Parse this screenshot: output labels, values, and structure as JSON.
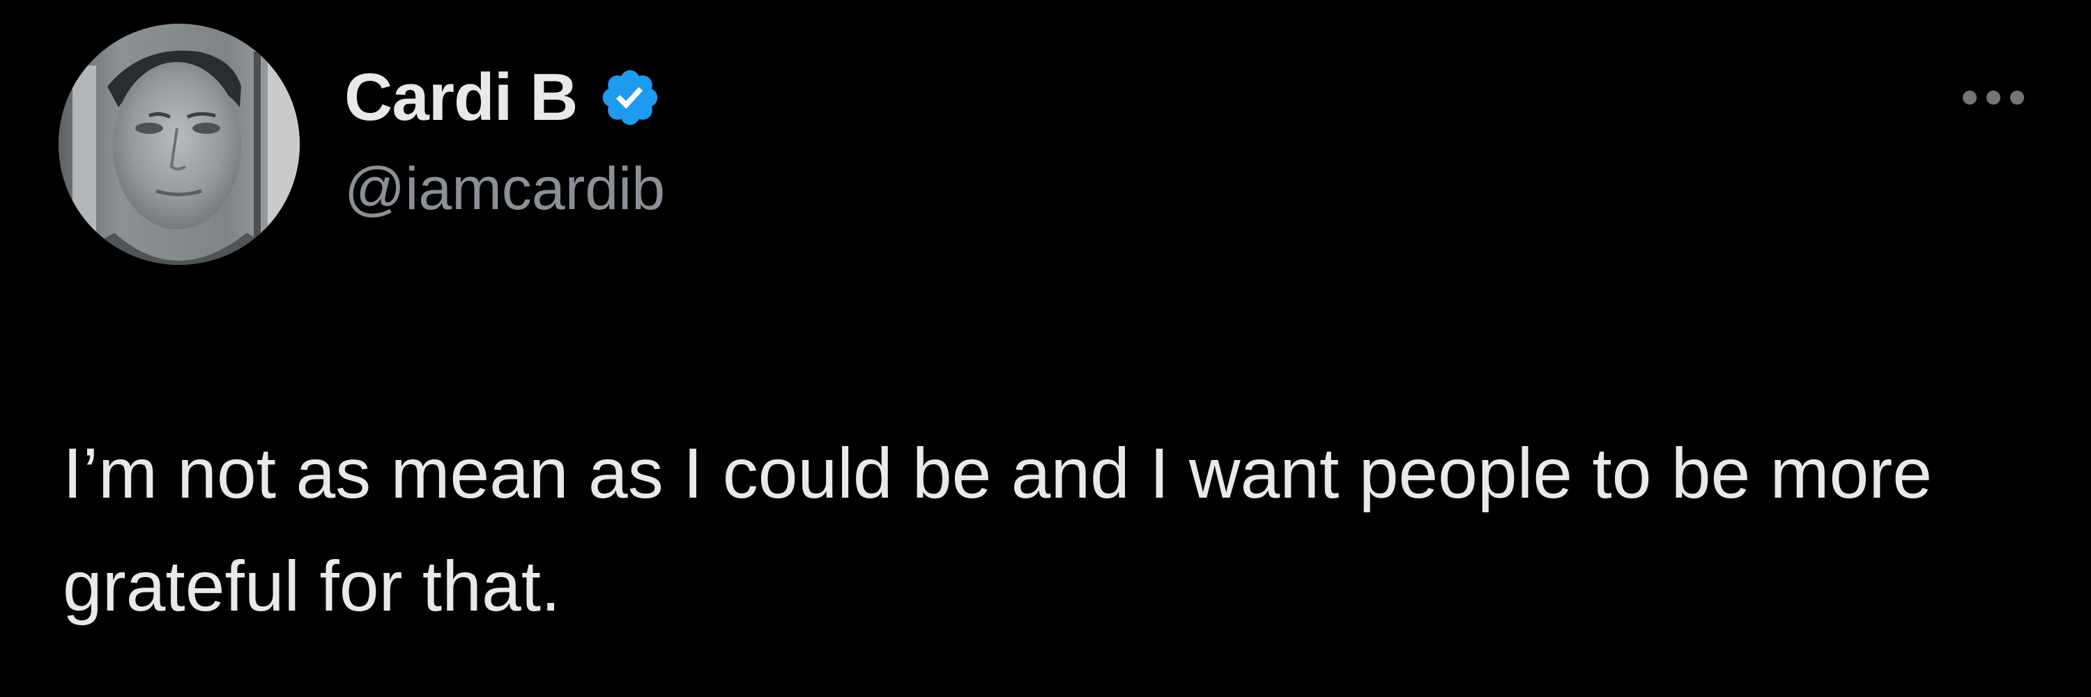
{
  "tweet": {
    "author": {
      "display_name": "Cardi B",
      "handle": "@iamcardib",
      "verified": true,
      "verified_icon": "verified-badge-icon"
    },
    "more_icon": "more-options-icon",
    "text": "I’m not as mean as I could be and I want people to be more grateful for that."
  },
  "colors": {
    "background": "#000000",
    "primary_text": "#e7e9ea",
    "secondary_text": "#8b9096",
    "verified_blue": "#1d9bf0",
    "more_dots": "#71767b"
  }
}
